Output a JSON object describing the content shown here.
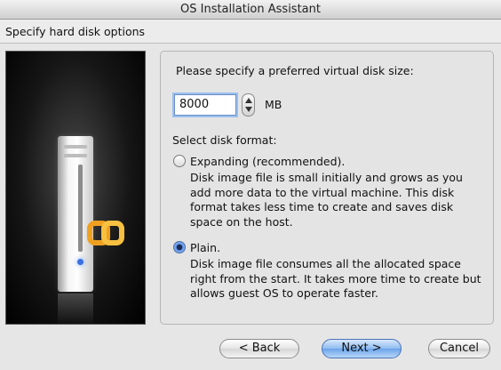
{
  "window": {
    "title": "OS Installation Assistant"
  },
  "header": {
    "title": "Specify hard disk options"
  },
  "disk_size": {
    "prompt": "Please specify a preferred virtual disk size:",
    "value": "8000",
    "unit": "MB"
  },
  "format": {
    "label": "Select disk format:",
    "selected": "plain",
    "options": [
      {
        "id": "expanding",
        "label": "Expanding (recommended).",
        "description": "Disk image file is small initially and grows as you add more data to the virtual machine. This disk format takes less time to create and saves disk space on the host."
      },
      {
        "id": "plain",
        "label": "Plain.",
        "description": "Disk image file consumes all the allocated space right from the start. It takes more time to create but allows guest OS to operate faster."
      }
    ]
  },
  "buttons": {
    "back": "< Back",
    "next": "Next >",
    "cancel": "Cancel"
  },
  "icons": {
    "logo": "parallels-logo-icon",
    "computer": "computer-tower-icon"
  },
  "colors": {
    "accent": "#5d93e6",
    "logo_orange": "#f0a020",
    "led": "#3a6fe0"
  }
}
